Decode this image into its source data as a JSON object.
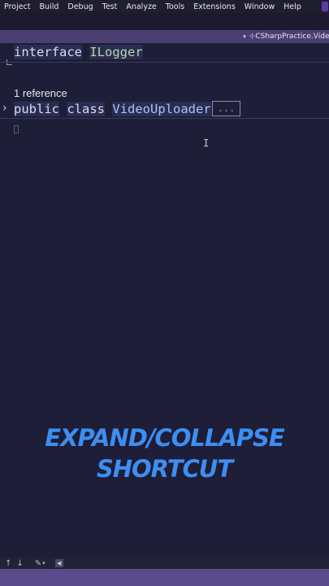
{
  "menu": {
    "items": [
      "Project",
      "Build",
      "Debug",
      "Test",
      "Analyze",
      "Tools",
      "Extensions",
      "Window",
      "Help"
    ]
  },
  "tab": {
    "caret": "▾",
    "namespace": "⊹CSharpPractice.Video"
  },
  "editor": {
    "interface_line": {
      "keyword": "interface",
      "name": "ILogger"
    },
    "codelens": "1 reference",
    "class_line": {
      "keyword1": "public",
      "keyword2": "class",
      "name": "VideoUploader",
      "collapsed": "..."
    }
  },
  "overlay": {
    "line1": "EXPAND/COLLAPSE",
    "line2": "SHORTCUT"
  },
  "colors": {
    "accent_text": "#3d8ef0",
    "interface_name": "#b8d7a3",
    "class_name": "#a9c4f2",
    "bottom_bar": "#5a4c8a"
  },
  "icons": {
    "statusbar": [
      "arrow-up-icon",
      "arrow-down-icon",
      "brush-icon",
      "dropdown-icon",
      "scroll-left-icon"
    ]
  }
}
